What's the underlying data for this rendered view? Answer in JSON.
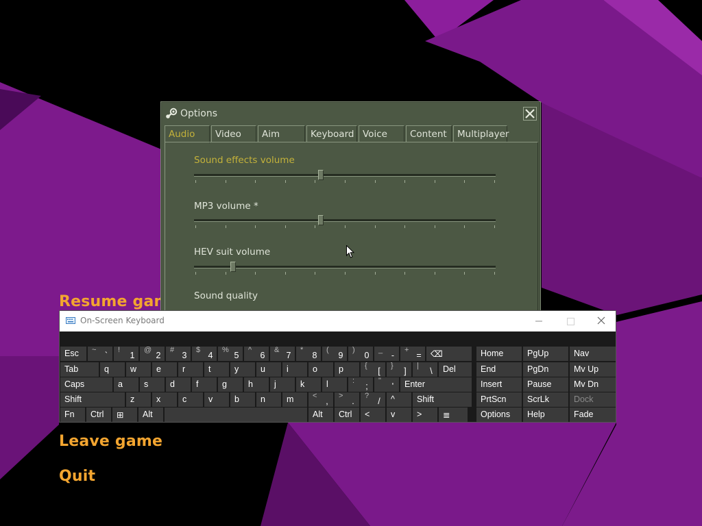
{
  "main_menu": {
    "resume": "Resume game",
    "leave": "Leave game",
    "quit": "Quit"
  },
  "options": {
    "title": "Options",
    "tabs": [
      "Audio",
      "Video",
      "Aim",
      "Keyboard",
      "Voice",
      "Content",
      "Multiplayer"
    ],
    "active_tab": "Audio",
    "sliders": [
      {
        "label": "Sound effects volume",
        "value": 0.42
      },
      {
        "label": "MP3 volume *",
        "value": 0.42
      },
      {
        "label": "HEV suit volume",
        "value": 0.13
      }
    ],
    "sound_quality_label": "Sound quality"
  },
  "osk": {
    "title": "On-Screen Keyboard",
    "rows": [
      [
        {
          "k": "Esc",
          "w": 40
        },
        {
          "k": "`",
          "s": "~",
          "w": 38
        },
        {
          "k": "1",
          "s": "!",
          "w": 38
        },
        {
          "k": "2",
          "s": "@",
          "w": 38
        },
        {
          "k": "3",
          "s": "#",
          "w": 38
        },
        {
          "k": "4",
          "s": "$",
          "w": 38
        },
        {
          "k": "5",
          "s": "%",
          "w": 38
        },
        {
          "k": "6",
          "s": "^",
          "w": 38
        },
        {
          "k": "7",
          "s": "&",
          "w": 38
        },
        {
          "k": "8",
          "s": "*",
          "w": 38
        },
        {
          "k": "9",
          "s": "(",
          "w": 38
        },
        {
          "k": "0",
          "s": ")",
          "w": 38
        },
        {
          "k": "-",
          "s": "_",
          "w": 38
        },
        {
          "k": "=",
          "s": "+",
          "w": 38
        },
        {
          "k": "⌫",
          "w": 68
        }
      ],
      [
        {
          "k": "Tab",
          "w": 58
        },
        {
          "k": "q",
          "w": 38
        },
        {
          "k": "w",
          "w": 38
        },
        {
          "k": "e",
          "w": 38
        },
        {
          "k": "r",
          "w": 38
        },
        {
          "k": "t",
          "w": 38
        },
        {
          "k": "y",
          "w": 38
        },
        {
          "k": "u",
          "w": 38
        },
        {
          "k": "i",
          "w": 38
        },
        {
          "k": "o",
          "w": 38
        },
        {
          "k": "p",
          "w": 38
        },
        {
          "k": "[",
          "s": "{",
          "w": 38
        },
        {
          "k": "]",
          "s": "}",
          "w": 38
        },
        {
          "k": "\\",
          "s": "|",
          "w": 38
        },
        {
          "k": "Del",
          "w": 50
        }
      ],
      [
        {
          "k": "Caps",
          "w": 78
        },
        {
          "k": "a",
          "w": 38
        },
        {
          "k": "s",
          "w": 38
        },
        {
          "k": "d",
          "w": 38
        },
        {
          "k": "f",
          "w": 38
        },
        {
          "k": "g",
          "w": 38
        },
        {
          "k": "h",
          "w": 38
        },
        {
          "k": "j",
          "w": 38
        },
        {
          "k": "k",
          "w": 38
        },
        {
          "k": "l",
          "w": 38
        },
        {
          "k": ";",
          "s": ":",
          "w": 38
        },
        {
          "k": "'",
          "s": "\"",
          "w": 38
        },
        {
          "k": "Enter",
          "w": 106
        }
      ],
      [
        {
          "k": "Shift",
          "w": 96
        },
        {
          "k": "z",
          "w": 38
        },
        {
          "k": "x",
          "w": 38
        },
        {
          "k": "c",
          "w": 38
        },
        {
          "k": "v",
          "w": 38
        },
        {
          "k": "b",
          "w": 38
        },
        {
          "k": "n",
          "w": 38
        },
        {
          "k": "m",
          "w": 38
        },
        {
          "k": ",",
          "s": "<",
          "w": 38
        },
        {
          "k": ".",
          "s": ">",
          "w": 38
        },
        {
          "k": "/",
          "s": "?",
          "w": 38
        },
        {
          "k": "^",
          "w": 38
        },
        {
          "k": "Shift",
          "w": 88
        }
      ],
      [
        {
          "k": "Fn",
          "w": 38
        },
        {
          "k": "Ctrl",
          "w": 38
        },
        {
          "k": "⊞",
          "w": 38
        },
        {
          "k": "Alt",
          "w": 38
        },
        {
          "k": "",
          "w": 210
        },
        {
          "k": "Alt",
          "w": 38
        },
        {
          "k": "Ctrl",
          "w": 38
        },
        {
          "k": "<",
          "w": 38
        },
        {
          "k": "v",
          "w": 38
        },
        {
          "k": ">",
          "w": 38
        },
        {
          "k": "≣",
          "w": 44
        }
      ]
    ],
    "side_rows": [
      [
        {
          "k": "Home"
        },
        {
          "k": "PgUp"
        },
        {
          "k": "Nav"
        }
      ],
      [
        {
          "k": "End"
        },
        {
          "k": "PgDn"
        },
        {
          "k": "Mv Up"
        }
      ],
      [
        {
          "k": "Insert"
        },
        {
          "k": "Pause"
        },
        {
          "k": "Mv Dn"
        }
      ],
      [
        {
          "k": "PrtScn"
        },
        {
          "k": "ScrLk"
        },
        {
          "k": "Dock",
          "disabled": true
        }
      ],
      [
        {
          "k": "Options"
        },
        {
          "k": "Help"
        },
        {
          "k": "Fade"
        }
      ]
    ]
  },
  "colors": {
    "menu_accent": "#f3a530",
    "panel_bg": "#4c5844",
    "active_tab_text": "#c4b23a"
  }
}
